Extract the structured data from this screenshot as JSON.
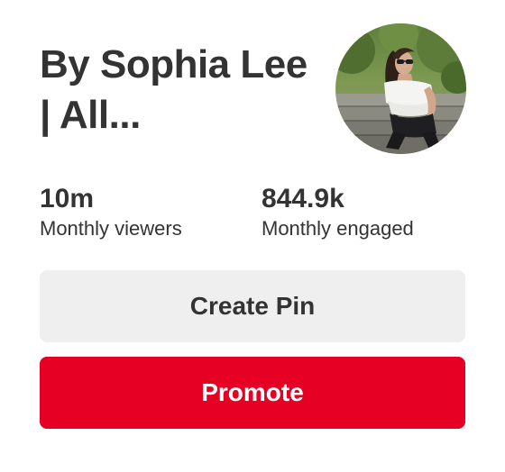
{
  "profile": {
    "name_line1": "By Sophia Lee",
    "name_line2": "| All...",
    "avatar_icon": "profile-photo"
  },
  "stats": [
    {
      "value": "10m",
      "label": "Monthly viewers"
    },
    {
      "value": "844.9k",
      "label": "Monthly engaged"
    }
  ],
  "actions": {
    "create_pin_label": "Create Pin",
    "promote_label": "Promote"
  },
  "colors": {
    "text": "#333333",
    "secondary_button_bg": "#efefef",
    "primary_button_bg": "#e60023",
    "primary_button_text": "#ffffff"
  }
}
